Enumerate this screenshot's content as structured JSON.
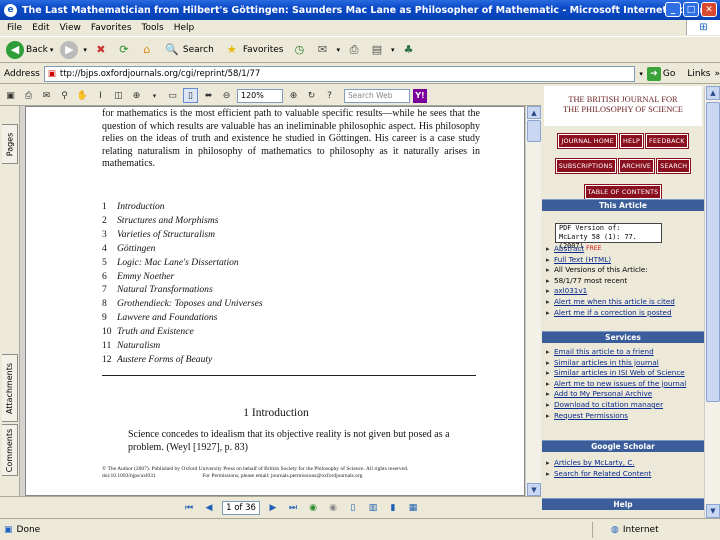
{
  "window": {
    "title": "The Last Mathematician from Hilbert's Göttingen: Saunders Mac Lane as Philosopher of Mathematic - Microsoft Internet Explorer",
    "controls": [
      "_",
      "□",
      "✕"
    ]
  },
  "menu": [
    "File",
    "Edit",
    "View",
    "Favorites",
    "Tools",
    "Help"
  ],
  "toolbar": {
    "back": "Back",
    "search": "Search",
    "favorites": "Favorites"
  },
  "address": {
    "label": "Address",
    "url": "ttp://bjps.oxfordjournals.org/cgi/reprint/58/1/77",
    "go": "Go",
    "links": "Links",
    "more": "»"
  },
  "pdf": {
    "zoom": "120%",
    "search_placeholder": "Search Web",
    "yahoo": "Y!",
    "side_tabs": [
      "Pages",
      "Attachments",
      "Comments"
    ],
    "intro": "for mathematics is the most efficient path to valuable specific results—while he sees that the question of which results are valuable has an ineliminable philosophic aspect. His philosophy relies on the ideas of truth and existence he studied in Göttingen. His career is a case study relating naturalism in philosophy of mathematics to philosophy as it naturally arises in mathematics.",
    "toc": [
      {
        "n": "1",
        "t": "Introduction"
      },
      {
        "n": "2",
        "t": "Structures and Morphisms"
      },
      {
        "n": "3",
        "t": "Varieties of Structuralism"
      },
      {
        "n": "4",
        "t": "Göttingen"
      },
      {
        "n": "5",
        "t": "Logic: Mac Lane's Dissertation"
      },
      {
        "n": "6",
        "t": "Emmy Noether"
      },
      {
        "n": "7",
        "t": "Natural Transformations"
      },
      {
        "n": "8",
        "t": "Grothendieck: Toposes and Universes"
      },
      {
        "n": "9",
        "t": "Lawvere and Foundations"
      },
      {
        "n": "10",
        "t": "Truth and Existence"
      },
      {
        "n": "11",
        "t": "Naturalism"
      },
      {
        "n": "12",
        "t": "Austere Forms of Beauty"
      }
    ],
    "section_heading": "1   Introduction",
    "section_text": "Science concedes to idealism that its objective reality is not given but posed as a problem. (Weyl [1927], p. 83)",
    "footnote_1": "© The Author (2007). Published by Oxford University Press on behalf of British Society for the Philosophy of Science. All rights reserved.",
    "footnote_2": "doi:10.1093/bjps/axl031                                  For Permissions, please email: journals.permissions@oxfordjournals.org",
    "page_box": "1 of 36"
  },
  "web": {
    "journal_line1": "THE BRITISH JOURNAL FOR",
    "journal_line2": "THE PHILOSOPHY OF SCIENCE",
    "buttons_row1": [
      "JOURNAL HOME",
      "HELP",
      "FEEDBACK"
    ],
    "buttons_row2": [
      "SUBSCRIPTIONS",
      "ARCHIVE",
      "SEARCH"
    ],
    "toc_button": "TABLE OF CONTENTS",
    "this_article": "This Article",
    "citation_line1": "PDF Version of:",
    "citation_line2": "McLarty 58 (1): 77. (2007)",
    "article_links": [
      {
        "text": "Abstract",
        "badge": "FREE"
      },
      {
        "text": "Full Text (HTML)"
      },
      {
        "text": "All Versions of this Article:",
        "plain": true
      },
      {
        "text": "58/1/77    most recent",
        "plain": true
      },
      {
        "text": "axl031v1"
      },
      {
        "text": "Alert me when this article is cited"
      },
      {
        "text": "Alert me if a correction is posted"
      }
    ],
    "services": "Services",
    "service_links": [
      "Email this article to a friend",
      "Similar articles in this journal",
      "Similar articles in ISI Web of Science",
      "Alert me to new issues of the journal",
      "Add to My Personal Archive",
      "Download to citation manager",
      "Request Permissions"
    ],
    "google_scholar": "Google Scholar",
    "scholar_links": [
      "Articles by McLarty, C.",
      "Search for Related Content"
    ],
    "help": "Help"
  },
  "status": {
    "left": "Done",
    "zone": "Internet"
  }
}
